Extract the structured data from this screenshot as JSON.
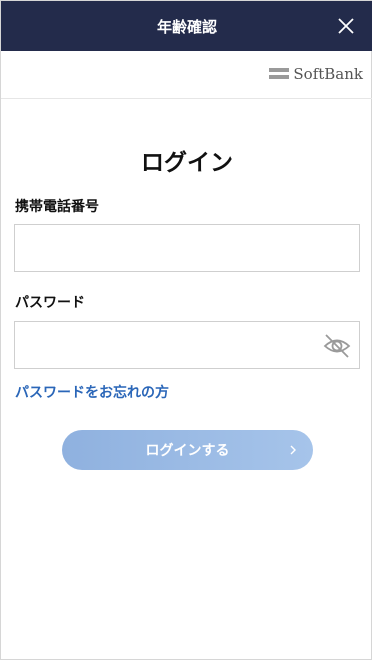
{
  "header": {
    "title": "年齢確認",
    "close_icon": "close-icon"
  },
  "brand": {
    "name": "SoftBank",
    "icon": "softbank-bars-icon",
    "color": "#9a9a9a"
  },
  "form": {
    "title": "ログイン",
    "phone_label": "携帯電話番号",
    "phone_value": "",
    "password_label": "パスワード",
    "password_value": "",
    "password_toggle_icon": "eye-slash-icon",
    "forgot_link": "パスワードをお忘れの方",
    "submit_label": "ログインする",
    "submit_icon": "chevron-right-icon"
  },
  "colors": {
    "header_bg": "#232b4b",
    "link": "#2a66b8",
    "button": "#9dbbe6"
  }
}
